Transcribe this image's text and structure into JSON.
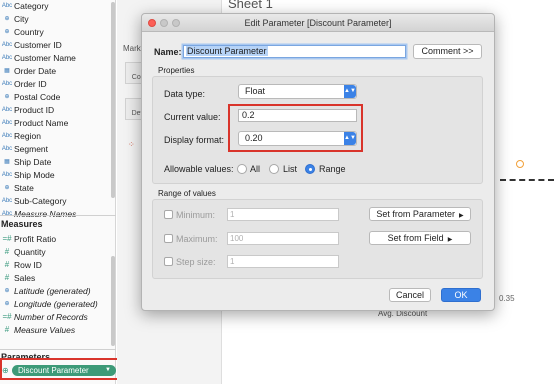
{
  "data_pane": {
    "dimensions": [
      {
        "label": "Category",
        "type": "Abc"
      },
      {
        "label": "City",
        "type": "globe"
      },
      {
        "label": "Country",
        "type": "globe"
      },
      {
        "label": "Customer ID",
        "type": "Abc"
      },
      {
        "label": "Customer Name",
        "type": "Abc"
      },
      {
        "label": "Order Date",
        "type": "calendar"
      },
      {
        "label": "Order ID",
        "type": "Abc"
      },
      {
        "label": "Postal Code",
        "type": "globe"
      },
      {
        "label": "Product ID",
        "type": "Abc"
      },
      {
        "label": "Product Name",
        "type": "Abc"
      },
      {
        "label": "Region",
        "type": "Abc"
      },
      {
        "label": "Segment",
        "type": "Abc"
      },
      {
        "label": "Ship Date",
        "type": "calendar"
      },
      {
        "label": "Ship Mode",
        "type": "Abc"
      },
      {
        "label": "State",
        "type": "globe"
      },
      {
        "label": "Sub-Category",
        "type": "Abc"
      },
      {
        "label": "Measure Names",
        "type": "Abc"
      }
    ],
    "measures_header": "Measures",
    "measures": [
      {
        "label": "Profit Ratio",
        "type": "=#"
      },
      {
        "label": "Quantity",
        "type": "#"
      },
      {
        "label": "Row ID",
        "type": "#"
      },
      {
        "label": "Sales",
        "type": "#"
      },
      {
        "label": "Latitude (generated)",
        "type": "globe"
      },
      {
        "label": "Longitude (generated)",
        "type": "globe"
      },
      {
        "label": "Number of Records",
        "type": "=#"
      },
      {
        "label": "Measure Values",
        "type": "#"
      }
    ],
    "parameters_header": "Parameters",
    "parameter_pill": "Discount Parameter"
  },
  "cards": {
    "marks_label": "Mark",
    "buttons": [
      "Colo",
      "Deta"
    ]
  },
  "sheet": {
    "title": "Sheet 1",
    "axis_tick": "0.35",
    "axis_label": "Avg. Discount"
  },
  "dialog": {
    "title": "Edit Parameter [Discount Parameter]",
    "name_label": "Name:",
    "name_value": "Discount Parameter",
    "comment_button": "Comment >>",
    "properties_header": "Properties",
    "data_type_label": "Data type:",
    "data_type_value": "Float",
    "current_value_label": "Current value:",
    "current_value": "0.2",
    "display_format_label": "Display format:",
    "display_format_value": "0.20",
    "allowable_label": "Allowable values:",
    "allowable_options": [
      "All",
      "List",
      "Range"
    ],
    "allowable_selected": "Range",
    "range_header": "Range of values",
    "minimum_label": "Minimum:",
    "minimum_value": "1",
    "maximum_label": "Maximum:",
    "maximum_value": "100",
    "step_label": "Step size:",
    "step_value": "1",
    "set_from_parameter": "Set from Parameter",
    "set_from_field": "Set from Field",
    "cancel": "Cancel",
    "ok": "OK"
  },
  "colors": {
    "accent": "#3b82e6",
    "highlight_red": "#d9342b",
    "param_green": "#3d9a78"
  }
}
